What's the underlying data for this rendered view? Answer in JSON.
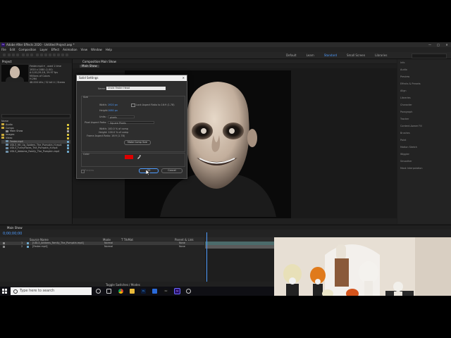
{
  "window": {
    "title": "Adobe After Effects 2020 - Untitled Project.aep *",
    "controls": [
      "—",
      "□",
      "✕"
    ]
  },
  "menu": [
    "File",
    "Edit",
    "Composition",
    "Layer",
    "Effect",
    "Animation",
    "View",
    "Window",
    "Help"
  ],
  "workspaces": [
    "Default",
    "Learn",
    "Standard",
    "Small Screen",
    "Libraries"
  ],
  "project": {
    "tab": "Project",
    "file_info": [
      "Fester.mp4 ▾ , used 1 time",
      "1920 x 1080 (1.00)",
      "Δ 0;01;29;18, 29.97 fps",
      "Millions of Colors",
      "H.264",
      "48.000 kHz / 32 bit U / Stereo"
    ],
    "tree": [
      {
        "label": "Name",
        "type": "header"
      },
      {
        "label": "Audio",
        "type": "folder",
        "color": "#d6c13a"
      },
      {
        "label": "Comps",
        "type": "folder",
        "color": "#d6c13a"
      },
      {
        "label": "Main Show",
        "type": "comp",
        "color": "#a6a6a6"
      },
      {
        "label": "Images",
        "type": "folder",
        "color": "#d6c13a"
      },
      {
        "label": "Video",
        "type": "folder",
        "color": "#d6c13a"
      },
      {
        "label": "Fester.mp4",
        "type": "video",
        "color": "#6ea7c9",
        "selected": true
      },
      {
        "label": "UDL3_Hit_Up_Spiders_The_Pumpkin_H.mp4",
        "type": "video",
        "color": "#6ea7c9"
      },
      {
        "label": "UDL3_FunnyFaces_The_Pumpkin_H.mp4",
        "type": "video",
        "color": "#6ea7c9"
      },
      {
        "label": "UDL3_Addams_Family_The_Pumpkin.mp4",
        "type": "video",
        "color": "#6ea7c9"
      }
    ]
  },
  "composition": {
    "tab": "Composition Main Show",
    "subtab": "Main Show"
  },
  "right_panel": [
    "Info",
    "Audio",
    "Preview",
    "Effects & Presets",
    "Align",
    "Libraries",
    "Character",
    "Paragraph",
    "Tracker",
    "Content-Aware Fill",
    "Brushes",
    "Paint",
    "Motion Sketch",
    "Wiggler",
    "Smoother",
    "Mask Interpolation"
  ],
  "dialog": {
    "title": "Solid Settings",
    "close": "✕",
    "name_label": "Name:",
    "name_value": "Uncle Fester Head",
    "size_label": "Size",
    "width_label": "Width:",
    "width_value": "1920 px",
    "height_label": "Height:",
    "height_value": "1080 px",
    "lock_label": "Lock Aspect Ratio to 16:9 (1.78)",
    "units_label": "Units:",
    "units_value": "pixels",
    "par_label": "Pixel Aspect Ratio:",
    "par_value": "Square Pixels",
    "info_lines": [
      "Width: 100.0 % of comp",
      "Height: 100.0 % of comp",
      "Frame Aspect Ratio: 16:9 (1.78)"
    ],
    "make_comp_size": "Make Comp Size",
    "color_label": "Color",
    "swatch_color": "#dd0000",
    "preview_label": "Preview",
    "ok": "OK",
    "cancel": "Cancel"
  },
  "timeline": {
    "tab": "Main Show",
    "timecode": "0;00;00;00",
    "layers": [
      {
        "num": "1",
        "name": "[UDL3_Addams_Family_The_Pumpkin.mp4]",
        "mode": "Normal",
        "parent": "None",
        "selected": true
      },
      {
        "num": "2",
        "name": "[Fester.mp4]",
        "mode": "Normal",
        "parent": "None",
        "selected": false
      }
    ],
    "columns": [
      "Source Name",
      "Mode",
      "T  TrkMat",
      "Parent & Link"
    ],
    "footer": "Toggle Switches / Modes"
  },
  "taskbar": {
    "search_placeholder": "Type here to search",
    "icons": [
      "task-view-icon",
      "chrome-icon",
      "file-explorer-icon",
      "photoshop-icon",
      "mail-icon",
      "creative-cloud-icon",
      "after-effects-icon",
      "obs-icon"
    ]
  }
}
